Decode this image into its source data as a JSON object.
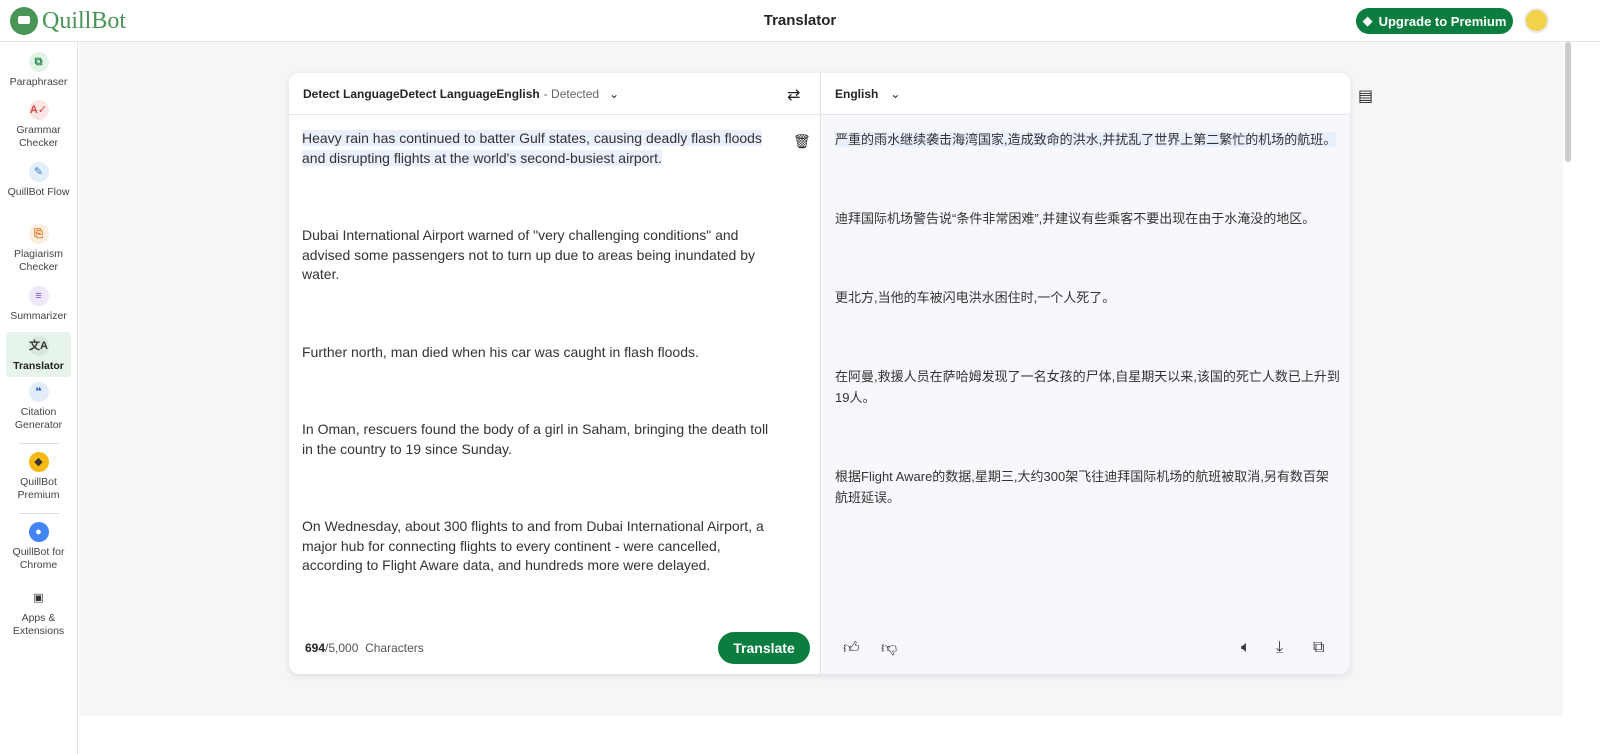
{
  "app": {
    "logo": "QuillBot",
    "title": "Translator",
    "upgrade": "Upgrade to Premium"
  },
  "sidebar": [
    {
      "label": "Paraphraser",
      "icon": "paraphraser-icon",
      "color": "#2f8f52",
      "bg": "#e3f3e8",
      "glyph": "⧉"
    },
    {
      "label": "Grammar Checker",
      "icon": "grammar-icon",
      "color": "#d9453a",
      "bg": "#fbe6e5",
      "glyph": "A✓"
    },
    {
      "label": "QuillBot Flow",
      "icon": "quill-icon",
      "color": "#2a7bd1",
      "bg": "#e3effa",
      "glyph": "✎"
    },
    {
      "label": "Plagiarism Checker",
      "icon": "plagiarism-icon",
      "color": "#e27a1c",
      "bg": "#fcefe2",
      "glyph": "⎘"
    },
    {
      "label": "Summarizer",
      "icon": "summarizer-icon",
      "color": "#7c4ddb",
      "bg": "#efe8fb",
      "glyph": "≡"
    },
    {
      "label": "Translator",
      "icon": "translate-icon",
      "color": "#333",
      "bg": "#d9e8df",
      "glyph": "文A"
    },
    {
      "label": "Citation Generator",
      "icon": "quote-icon",
      "color": "#1e5fc2",
      "bg": "#e3edfa",
      "glyph": "❝"
    },
    {
      "label": "QuillBot Premium",
      "icon": "premium-icon",
      "color": "#333",
      "bg": "#f5b915",
      "glyph": "◆"
    },
    {
      "label": "QuillBot for Chrome",
      "icon": "chrome-icon",
      "color": "#fff",
      "bg": "#4285f4",
      "glyph": "●"
    },
    {
      "label": "Apps & Extensions",
      "icon": "apps-icon",
      "color": "#333",
      "bg": "transparent",
      "glyph": "▣"
    }
  ],
  "source": {
    "lang": "Detect LanguageDetect LanguageEnglish",
    "detected": "- Detected",
    "paragraphs": [
      "Heavy rain has continued to batter Gulf states, causing deadly flash floods and disrupting flights at the world's second-busiest airport.",
      "Dubai International Airport warned of \"very challenging conditions\" and advised some passengers not to turn up due to areas being inundated by water.",
      "Further north,  man died when his car was caught in flash floods.",
      "In Oman, rescuers found the body of a girl in Saham, bringing the death toll in the country to 19 since Sunday.",
      "On Wednesday, about 300 flights to and from Dubai International Airport, a major hub for connecting flights to every continent - were cancelled, according to Flight Aware data, and hundreds more were delayed."
    ],
    "count": "694",
    "limit": "/5,000",
    "count_label": "Characters",
    "translate": "Translate"
  },
  "target": {
    "lang": "English",
    "paragraphs": [
      "严重的雨水继续袭击海湾国家,造成致命的洪水,并扰乱了世界上第二繁忙的机场的航班。",
      "迪拜国际机场警告说“条件非常困难”,并建议有些乘客不要出现在由于水淹没的地区。",
      "更北方,当他的车被闪电洪水困住时,一个人死了。",
      "在阿曼,救援人员在萨哈姆发现了一名女孩的尸体,自星期天以来,该国的死亡人数已上升到19人。",
      "根据Flight Aware的数据,星期三,大约300架飞往迪拜国际机场的航班被取消,另有数百架航班延误。"
    ]
  }
}
